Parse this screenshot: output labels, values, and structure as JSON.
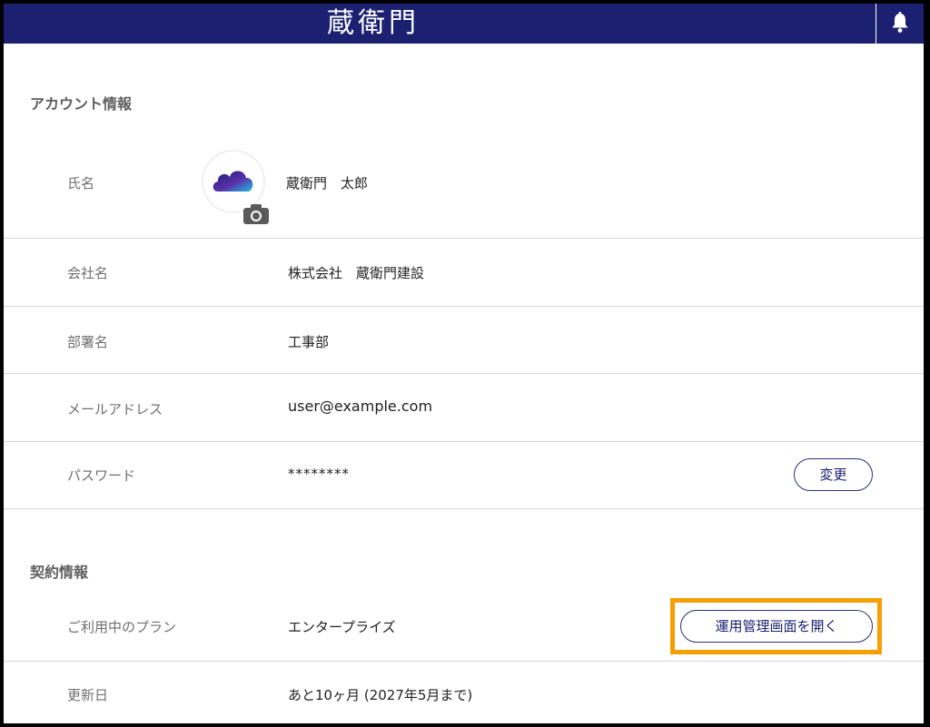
{
  "header": {
    "logo_text": "蔵衛門",
    "icons": {
      "bell": "bell-icon",
      "camera": "camera-icon",
      "avatar": "cloud-avatar"
    }
  },
  "colors": {
    "header_bg": "#1b2170",
    "highlight": "#f5a000",
    "divider": "#d9d9d9"
  },
  "account": {
    "title": "アカウント情報",
    "rows": [
      {
        "label": "氏名",
        "value": "蔵衛門　太郎"
      },
      {
        "label": "会社名",
        "value": "株式会社　蔵衛門建設"
      },
      {
        "label": "部署名",
        "value": "工事部"
      },
      {
        "label": "メールアドレス",
        "value": "user@example.com"
      },
      {
        "label": "パスワード",
        "value": "********",
        "button": "変更"
      }
    ]
  },
  "contract": {
    "title": "契約情報",
    "rows": [
      {
        "label": "ご利用中のプラン",
        "value": "エンタープライズ",
        "button": "運用管理画面を開く"
      },
      {
        "label": "更新日",
        "value": "あと10ヶ月 (2027年5月まで)"
      }
    ]
  }
}
